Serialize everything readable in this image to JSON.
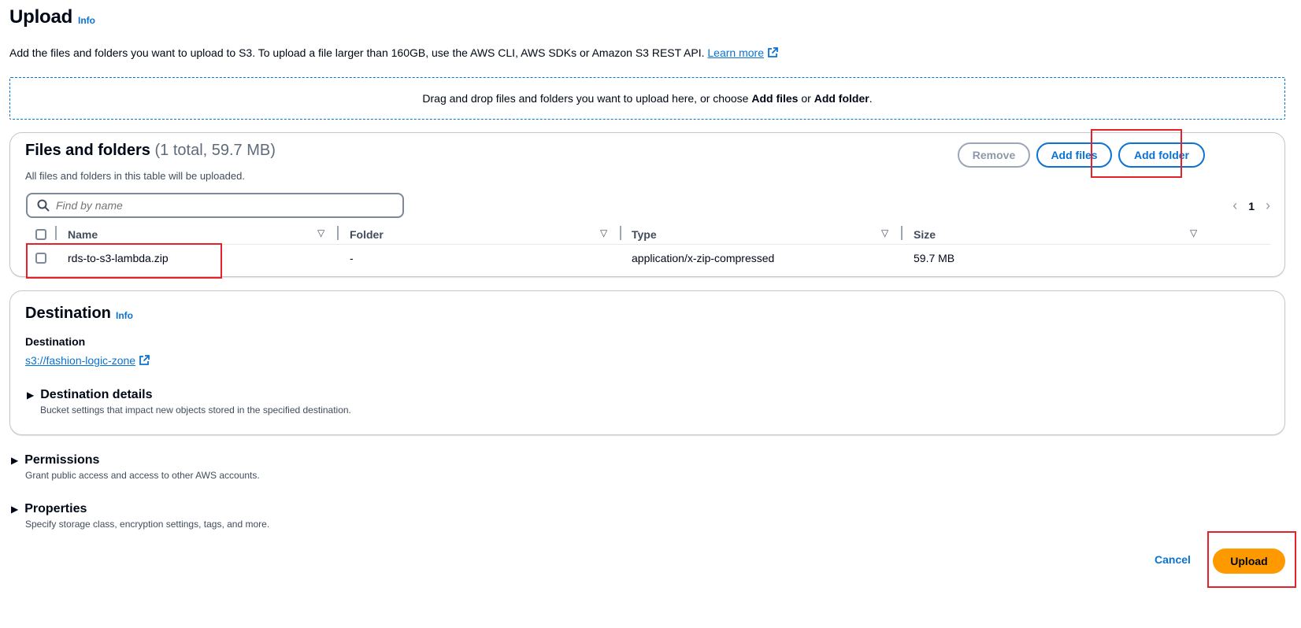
{
  "header": {
    "title": "Upload",
    "info": "Info",
    "intro_text": "Add the files and folders you want to upload to S3. To upload a file larger than 160GB, use the AWS CLI, AWS SDKs or Amazon S3 REST API.",
    "learn_more": "Learn more"
  },
  "dropzone": {
    "text_before": "Drag and drop files and folders you want to upload here, or choose",
    "add_files": "Add files",
    "or": "or",
    "add_folder": "Add folder",
    "period": "."
  },
  "files_panel": {
    "title": "Files and folders",
    "count": "(1 total, 59.7 MB)",
    "description": "All files and folders in this table will be uploaded.",
    "remove_label": "Remove",
    "add_files_label": "Add files",
    "add_folder_label": "Add folder",
    "search_placeholder": "Find by name",
    "page_number": "1",
    "columns": [
      "Name",
      "Folder",
      "Type",
      "Size"
    ],
    "rows": [
      {
        "name": "rds-to-s3-lambda.zip",
        "folder": "-",
        "type": "application/x-zip-compressed",
        "size": "59.7 MB"
      }
    ]
  },
  "destination_panel": {
    "title": "Destination",
    "info": "Info",
    "field_label": "Destination",
    "bucket_link": "s3://fashion-logic-zone",
    "details_label": "Destination details",
    "details_desc": "Bucket settings that impact new objects stored in the specified destination."
  },
  "permissions": {
    "label": "Permissions",
    "desc": "Grant public access and access to other AWS accounts."
  },
  "properties": {
    "label": "Properties",
    "desc": "Specify storage class, encryption settings, tags, and more."
  },
  "footer": {
    "cancel_label": "Cancel",
    "upload_label": "Upload"
  },
  "colors": {
    "link": "#0972d3",
    "primary_button": "#ff9900",
    "highlight": "#e5222a"
  }
}
